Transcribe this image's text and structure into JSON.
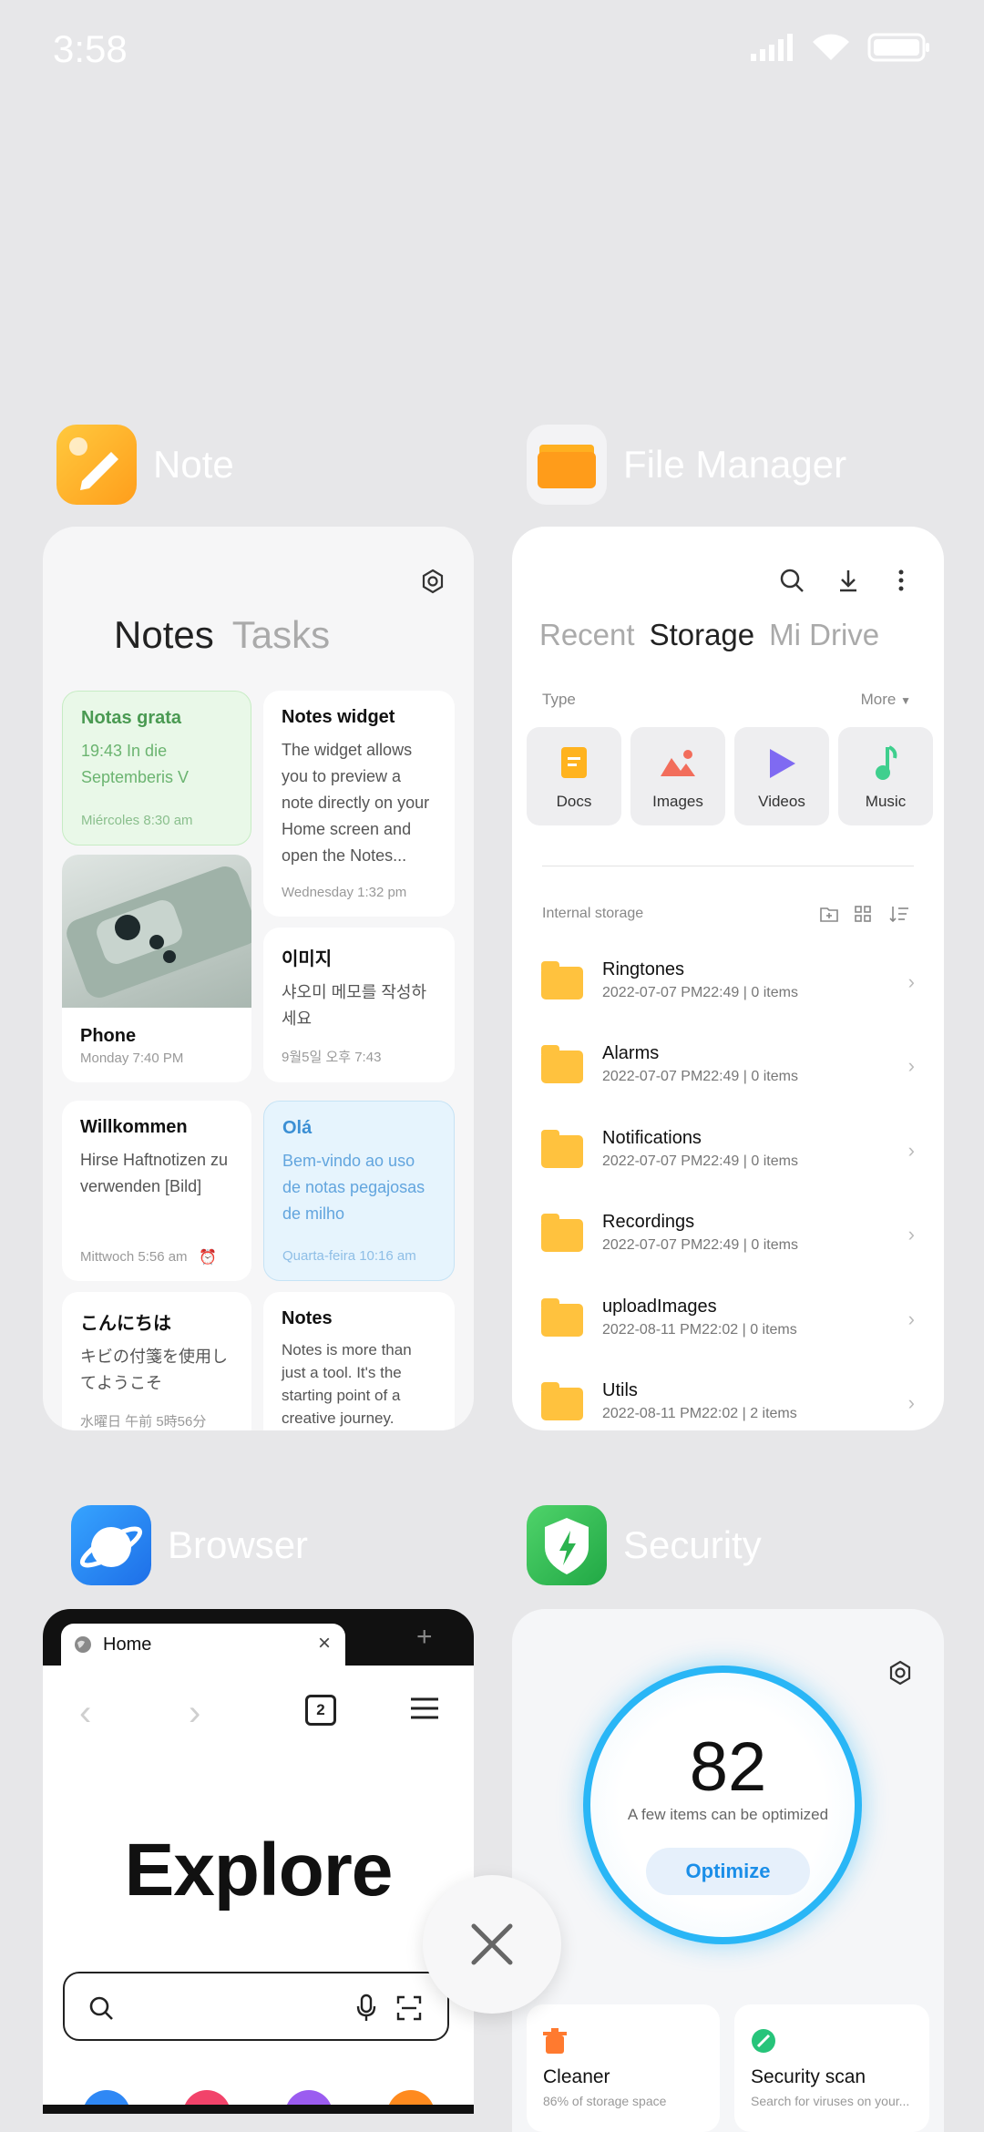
{
  "status": {
    "time": "3:58"
  },
  "apps": {
    "note": {
      "name": "Note"
    },
    "files": {
      "name": "File Manager"
    },
    "browser": {
      "name": "Browser"
    },
    "security": {
      "name": "Security"
    }
  },
  "note": {
    "tabs": [
      "Notes",
      "Tasks"
    ],
    "cards": [
      {
        "title": "Notas grata",
        "body": "19:43 In die Septemberis V",
        "date": "Miércoles 8:30 am"
      },
      {
        "title": "Notes widget",
        "body": "The widget allows you to preview a note directly on your Home screen and open the Notes...",
        "date": "Wednesday 1:32 pm"
      },
      {
        "title": "Phone",
        "date": "Monday 7:40 PM"
      },
      {
        "title": "이미지",
        "body": "샤오미 메모를 작성하세요",
        "date": "9월5일 오후 7:43"
      },
      {
        "title": "Willkommen",
        "body": "Hirse Haftnotizen zu verwenden [Bild]",
        "date": "Mittwoch 5:56 am"
      },
      {
        "title": "Olá",
        "body": "Bem-vindo ao uso de notas pegajosas de milho",
        "date": "Quarta-feira 10:16 am"
      },
      {
        "title": "こんにちは",
        "body": "キビの付箋を使用してようこそ",
        "date": "水曜日 午前 5時56分"
      },
      {
        "title": "Notes",
        "body": "Notes is more than just a tool. It's the starting point of a creative journey."
      }
    ]
  },
  "files": {
    "tabs": [
      "Recent",
      "Storage",
      "Mi Drive"
    ],
    "type_label": "Type",
    "more_label": "More",
    "types": [
      "Docs",
      "Images",
      "Videos",
      "Music"
    ],
    "internal_label": "Internal storage",
    "folders": [
      {
        "name": "Ringtones",
        "meta": "2022-07-07 PM22:49  |  0 items"
      },
      {
        "name": "Alarms",
        "meta": "2022-07-07 PM22:49  |  0 items"
      },
      {
        "name": "Notifications",
        "meta": "2022-07-07 PM22:49  |  0 items"
      },
      {
        "name": "Recordings",
        "meta": "2022-07-07 PM22:49  |  0 items"
      },
      {
        "name": "uploadImages",
        "meta": "2022-08-11 PM22:02  |  0 items"
      },
      {
        "name": "Utils",
        "meta": "2022-08-11 PM22:02  |  2 items"
      }
    ]
  },
  "browser": {
    "tab_title": "Home",
    "tab_count": "2",
    "brand": "Explore"
  },
  "security": {
    "score": "82",
    "subtitle": "A few items can be optimized",
    "optimize_label": "Optimize",
    "cleaner": {
      "title": "Cleaner",
      "sub": "86% of storage space"
    },
    "scan": {
      "title": "Security scan",
      "sub": "Search for viruses on your..."
    }
  },
  "colors": {
    "accent": "#1a8ee8",
    "ring": "#29b6f6",
    "note_green": "#e9f8e8",
    "note_blue": "#e6f4fd"
  }
}
